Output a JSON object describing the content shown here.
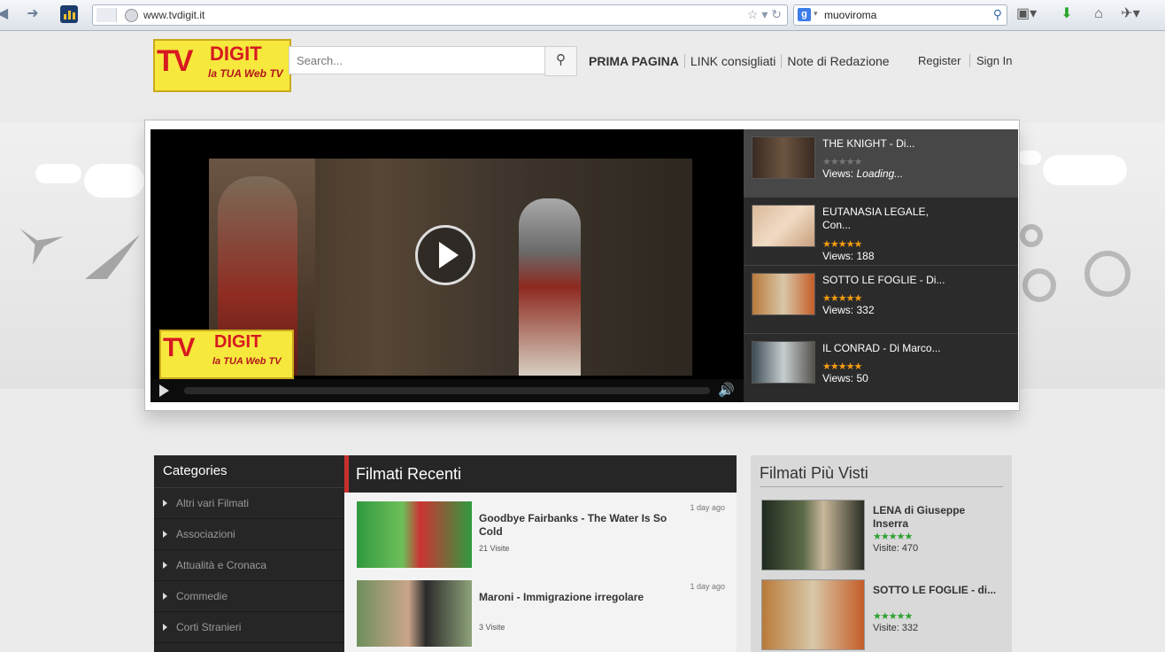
{
  "browser": {
    "url": "www.tvdigit.it",
    "search_value": "muoviroma",
    "search_engine_icon": "google-icon"
  },
  "site": {
    "logo": {
      "tv": "TV",
      "digit": "DIGIT",
      "tagline": "la TUA Web TV"
    },
    "search_placeholder": "Search...",
    "nav": [
      "PRIMA PAGINA",
      "LINK consigliati",
      "Note di Redazione"
    ],
    "auth": {
      "register": "Register",
      "sign_in": "Sign In"
    }
  },
  "player": {
    "playlist": [
      {
        "title": "THE KNIGHT - Di...",
        "rating": 0,
        "views_label": "Views:",
        "views": "Loading...",
        "active": true
      },
      {
        "title": "EUTANASIA LEGALE, Con...",
        "rating": 5,
        "views_label": "Views:",
        "views": "188",
        "active": false
      },
      {
        "title": "SOTTO LE FOGLIE - Di...",
        "rating": 5,
        "views_label": "Views:",
        "views": "332",
        "active": false
      },
      {
        "title": "IL CONRAD - Di Marco...",
        "rating": 5,
        "views_label": "Views:",
        "views": "50",
        "active": false
      }
    ]
  },
  "categories": {
    "title": "Categories",
    "items": [
      "Altri vari Filmati",
      "Associazioni",
      "Attualità e Cronaca",
      "Commedie",
      "Corti Stranieri"
    ]
  },
  "recent": {
    "title": "Filmati Recenti",
    "items": [
      {
        "title": "Goodbye Fairbanks - The Water Is So Cold",
        "visits": "21 Visite",
        "ago": "1 day ago"
      },
      {
        "title": "Maroni - Immigrazione irregolare",
        "visits": "3 Visite",
        "ago": "1 day ago"
      }
    ]
  },
  "most_viewed": {
    "title": "Filmati Più Visti",
    "items": [
      {
        "title": "LENA di Giuseppe Inserra",
        "rating": 5,
        "visits": "Visite: 470"
      },
      {
        "title": "SOTTO LE FOGLIE - di...",
        "rating": 5,
        "visits": "Visite: 332"
      }
    ]
  },
  "colors": {
    "accent_red": "#c9302c",
    "star_orange": "#f39c12",
    "star_green": "#2ea12e"
  }
}
